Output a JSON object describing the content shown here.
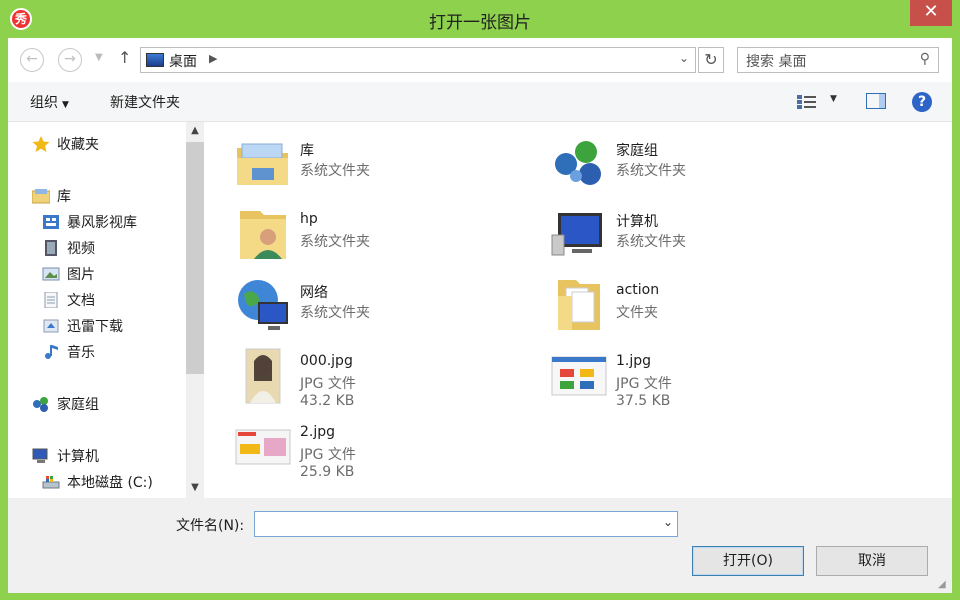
{
  "window": {
    "title": "打开一张图片",
    "app_icon": "秀",
    "close": "✕"
  },
  "nav": {
    "back_icon": "back-arrow-icon",
    "forward_icon": "forward-arrow-icon",
    "address": "桌面",
    "search_placeholder": "搜索 桌面"
  },
  "toolbar": {
    "organize": "组织",
    "new_folder": "新建文件夹"
  },
  "sidebar": {
    "favorites": "收藏夹",
    "libraries": "库",
    "lib_items": [
      "暴风影视库",
      "视频",
      "图片",
      "文档",
      "迅雷下载",
      "音乐"
    ],
    "homegroup": "家庭组",
    "computer": "计算机",
    "drive": "本地磁盘 (C:)"
  },
  "files": [
    {
      "name": "库",
      "type": "系统文件夹",
      "size": "",
      "icon": "library-icon"
    },
    {
      "name": "家庭组",
      "type": "系统文件夹",
      "size": "",
      "icon": "homegroup-icon"
    },
    {
      "name": "hp",
      "type": "系统文件夹",
      "size": "",
      "icon": "user-folder-icon"
    },
    {
      "name": "计算机",
      "type": "系统文件夹",
      "size": "",
      "icon": "computer-icon"
    },
    {
      "name": "网络",
      "type": "系统文件夹",
      "size": "",
      "icon": "network-icon"
    },
    {
      "name": "action",
      "type": "文件夹",
      "size": "",
      "icon": "folder-icon"
    },
    {
      "name": "000.jpg",
      "type": "JPG 文件",
      "size": "43.2 KB",
      "icon": "image-thumbnail-icon"
    },
    {
      "name": "1.jpg",
      "type": "JPG 文件",
      "size": "37.5 KB",
      "icon": "image-thumbnail-icon"
    },
    {
      "name": "2.jpg",
      "type": "JPG 文件",
      "size": "25.9 KB",
      "icon": "image-thumbnail-icon"
    }
  ],
  "bottom": {
    "filename_label": "文件名(N):",
    "filename_value": "",
    "open": "打开(O)",
    "cancel": "取消"
  },
  "colors": {
    "frame": "#8dd14c",
    "close": "#c7504a",
    "accent": "#2c64c8"
  }
}
